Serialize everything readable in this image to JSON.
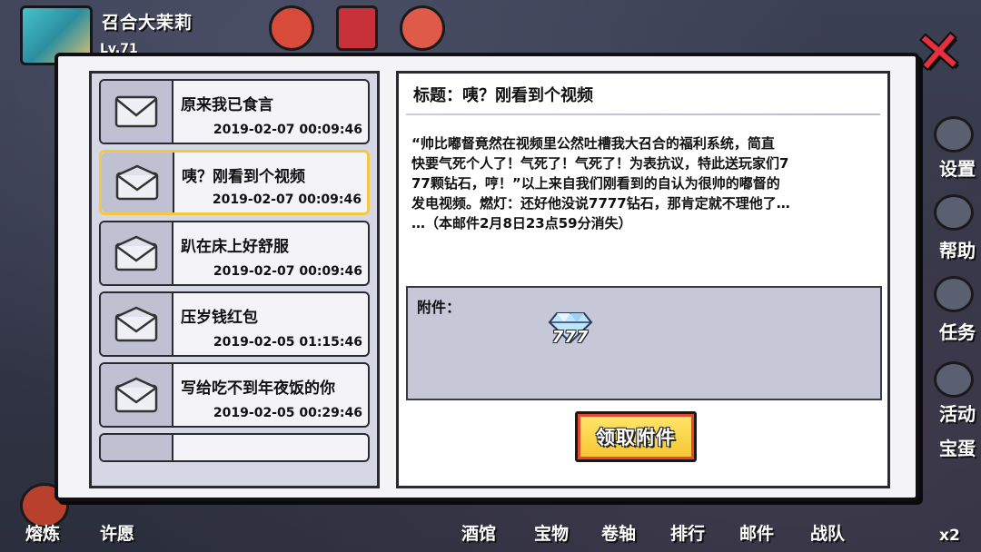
{
  "background": {
    "player_name": "召合大茉莉",
    "player_level": "Lv.71",
    "side_labels": [
      "设置",
      "帮助",
      "任务",
      "活动",
      "宝蛋"
    ],
    "bottom_labels": [
      "熔炼",
      "许愿",
      "酒馆",
      "宝物",
      "卷轴",
      "排行",
      "邮件",
      "战队"
    ],
    "multiplier": "x2"
  },
  "mail_list": [
    {
      "subject": "原来我已食言",
      "date": "2019-02-07 00:09:46"
    },
    {
      "subject": "咦？刚看到个视频",
      "date": "2019-02-07 00:09:46",
      "selected": true
    },
    {
      "subject": "趴在床上好舒服",
      "date": "2019-02-07 00:09:46"
    },
    {
      "subject": "压岁钱红包",
      "date": "2019-02-05 01:15:46"
    },
    {
      "subject": "写给吃不到年夜饭的你",
      "date": "2019-02-05 00:29:46"
    }
  ],
  "mail_detail": {
    "title": "标题：咦？刚看到个视频",
    "body": "“帅比嘟督竟然在视频里公然吐槽我大召合的福利系统，简直\n快要气死个人了！气死了！气死了！为表抗议，特此送玩家们7\n77颗钻石，哼！”以上来自我们刚看到的自认为很帅的嘟督的\n发电视频。燃灯：还好他没说7777钻石，那肯定就不理他了…\n…（本邮件2月8日23点59分消失）",
    "attachments_label": "附件：",
    "attachments": [
      {
        "icon": "diamond-icon",
        "count": "777"
      }
    ],
    "claim_label": "领取附件"
  },
  "colors": {
    "selected_border": "#f5c842",
    "claim_button": "#f6c431",
    "close_icon": "#e8303c"
  }
}
